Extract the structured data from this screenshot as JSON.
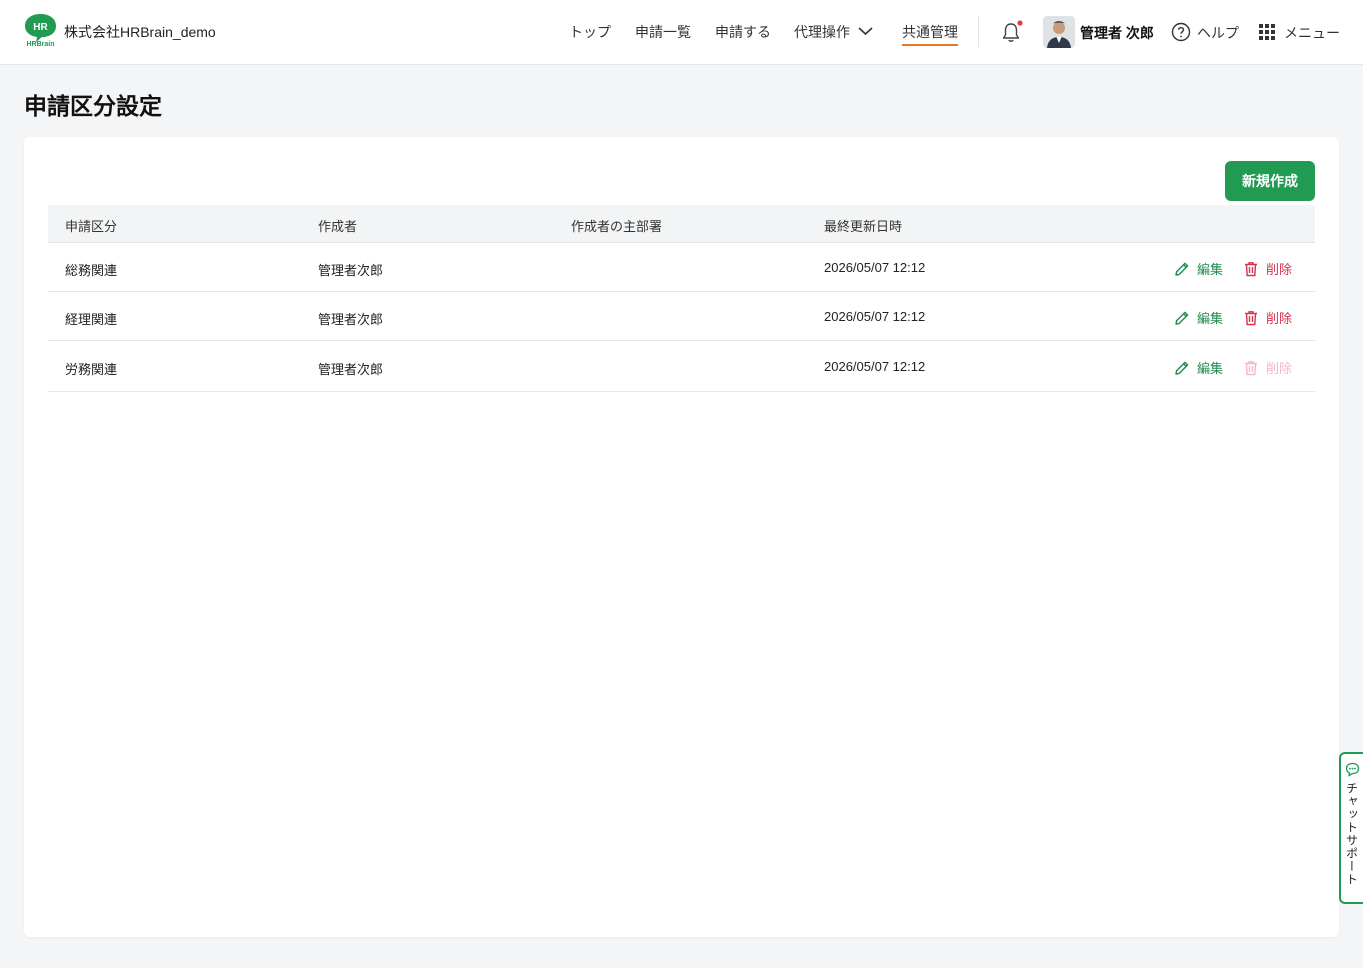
{
  "header": {
    "company": "株式会社HRBrain_demo",
    "logo_text": "HR",
    "logo_brand": "HRBrain",
    "nav": [
      {
        "label": "トップ"
      },
      {
        "label": "申請一覧"
      },
      {
        "label": "申請する"
      },
      {
        "label": "代理操作"
      },
      {
        "label": "共通管理"
      }
    ],
    "user_name": "管理者 次郎",
    "help_label": "ヘルプ",
    "menu_label": "メニュー"
  },
  "page": {
    "title": "申請区分設定",
    "new_button": "新規作成"
  },
  "table": {
    "columns": [
      "申請区分",
      "作成者",
      "作成者の主部署",
      "最終更新日時"
    ],
    "rows": [
      {
        "category": "総務関連",
        "creator": "管理者次郎",
        "department": "",
        "updated": "2026/05/07 12:12",
        "delete_enabled": true
      },
      {
        "category": "経理関連",
        "creator": "管理者次郎",
        "department": "",
        "updated": "2026/05/07 12:12",
        "delete_enabled": true
      },
      {
        "category": "労務関連",
        "creator": "管理者次郎",
        "department": "",
        "updated": "2026/05/07 12:12",
        "delete_enabled": false
      }
    ],
    "edit_label": "編集",
    "delete_label": "削除"
  },
  "chat": {
    "label": "チャットサポート"
  },
  "colors": {
    "brand_green": "#219a52",
    "active_underline": "#e8782a",
    "delete_red": "#d6334e",
    "notification_dot": "#e53950"
  }
}
